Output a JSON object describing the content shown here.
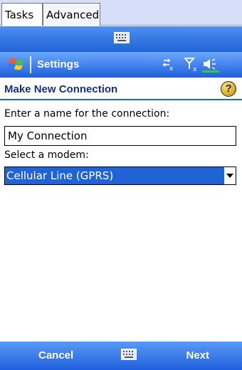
{
  "tabs": [
    {
      "label": "Tasks"
    },
    {
      "label": "Advanced"
    }
  ],
  "titlebar": {
    "title": "Settings",
    "start_icon": "windows-flag-icon",
    "tray_icons": [
      "connectivity-icon",
      "signal-off-icon",
      "volume-icon"
    ]
  },
  "section": {
    "title": "Make New Connection",
    "help_glyph": "?"
  },
  "form": {
    "name_label": "Enter a name for the connection:",
    "name_value": "My Connection",
    "modem_label": "Select a modem:",
    "modem_value": "Cellular Line (GPRS)"
  },
  "menubar": {
    "left_softkey": "Cancel",
    "right_softkey": "Next",
    "center_icon": "keyboard-icon"
  },
  "colors": {
    "accent": "#1f63d6",
    "header_text": "#16327a"
  }
}
